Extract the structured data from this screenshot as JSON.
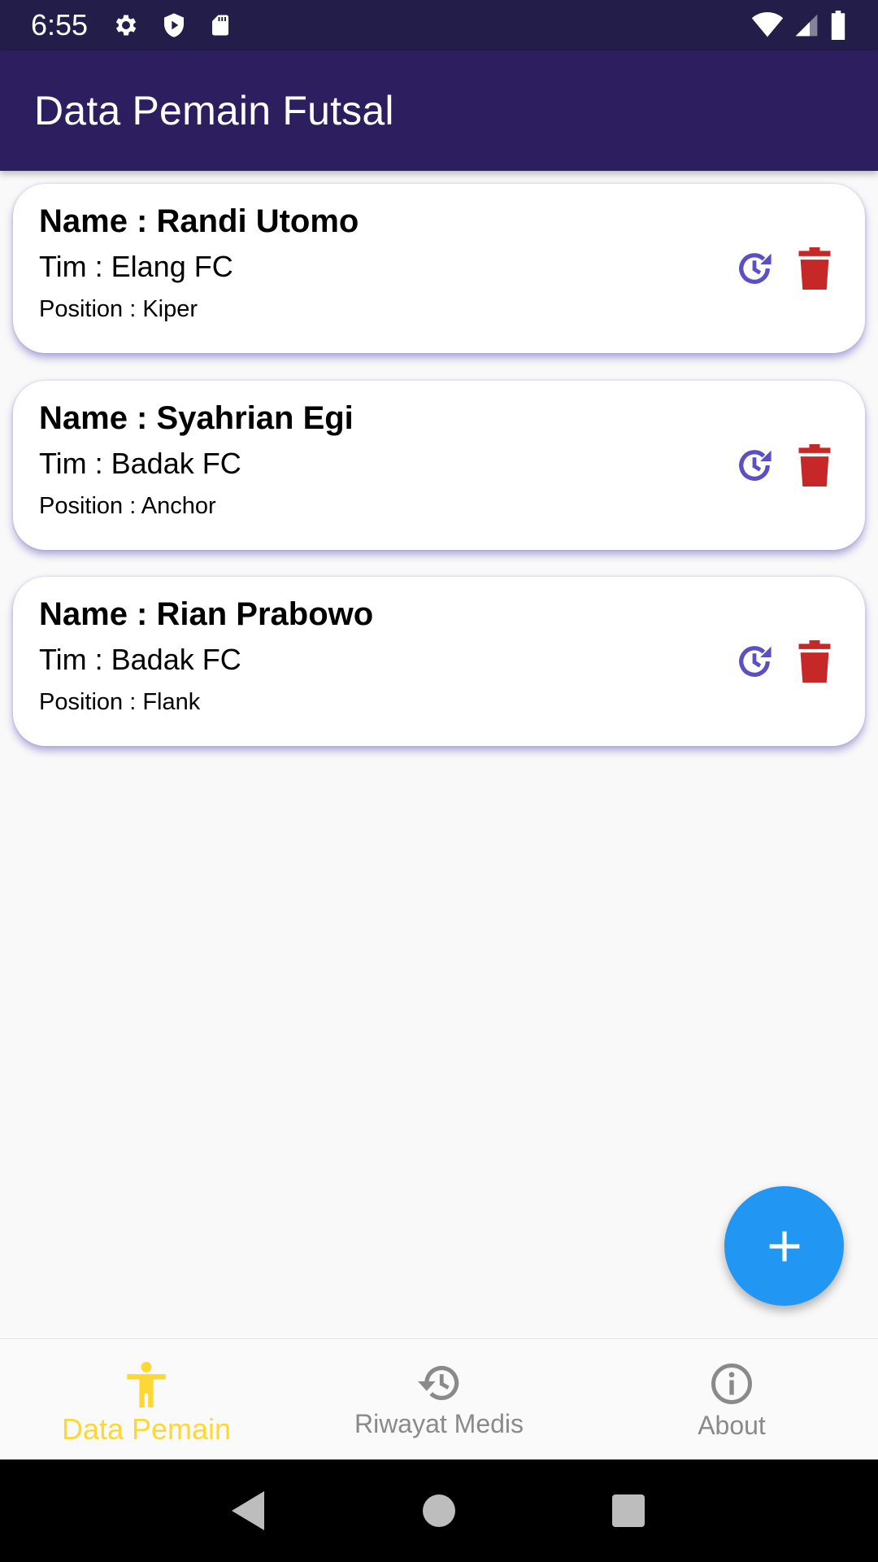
{
  "status_bar": {
    "time": "6:55",
    "left_icons": [
      "gear-icon",
      "shield-icon",
      "sd-card-icon"
    ],
    "right_icons": [
      "wifi-icon",
      "signal-icon",
      "battery-icon"
    ]
  },
  "app_bar": {
    "title": "Data Pemain Futsal"
  },
  "players": [
    {
      "name": "Name : Randi Utomo",
      "team": "Tim : Elang FC",
      "position": "Position : Kiper"
    },
    {
      "name": "Name : Syahrian Egi",
      "team": "Tim : Badak FC",
      "position": "Position : Anchor"
    },
    {
      "name": "Name : Rian Prabowo",
      "team": "Tim : Badak FC",
      "position": "Position : Flank"
    }
  ],
  "fab": {
    "icon": "plus-icon"
  },
  "bottom_nav": [
    {
      "label": "Data Pemain",
      "icon": "person-icon",
      "active": true
    },
    {
      "label": "Riwayat Medis",
      "icon": "history-icon",
      "active": false
    },
    {
      "label": "About",
      "icon": "info-icon",
      "active": false
    }
  ],
  "colors": {
    "status_bar": "#231d4a",
    "app_bar": "#2d1f5f",
    "history_action": "#5b4fc4",
    "delete_action": "#c62828",
    "fab": "#2196f3",
    "nav_active": "#fdd835",
    "nav_inactive": "#8a8a8a"
  }
}
